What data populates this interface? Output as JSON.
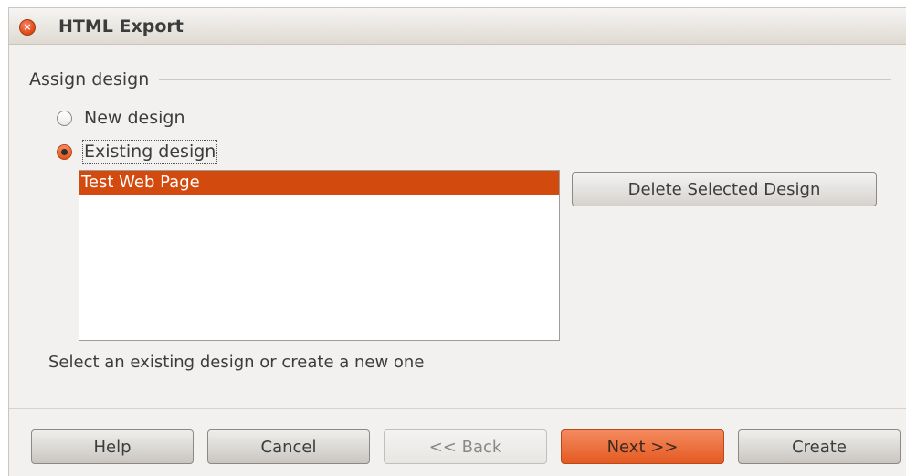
{
  "window": {
    "title": "HTML Export",
    "close_icon": "close-icon"
  },
  "section": {
    "label": "Assign design"
  },
  "options": {
    "new_design": {
      "label": "New design",
      "checked": false
    },
    "existing_design": {
      "label": "Existing design",
      "checked": true
    }
  },
  "designs": {
    "items": [
      "Test Web Page"
    ],
    "selected": "Test Web Page"
  },
  "delete_button": {
    "label": "Delete Selected Design"
  },
  "hint": "Select an existing design or create a new one",
  "buttons": {
    "help": "Help",
    "cancel": "Cancel",
    "back": "<< Back",
    "next": "Next >>",
    "create": "Create"
  },
  "colors": {
    "accent": "#d34a0e",
    "primary_button": "#e45a22",
    "background": "#f2f1f0"
  }
}
